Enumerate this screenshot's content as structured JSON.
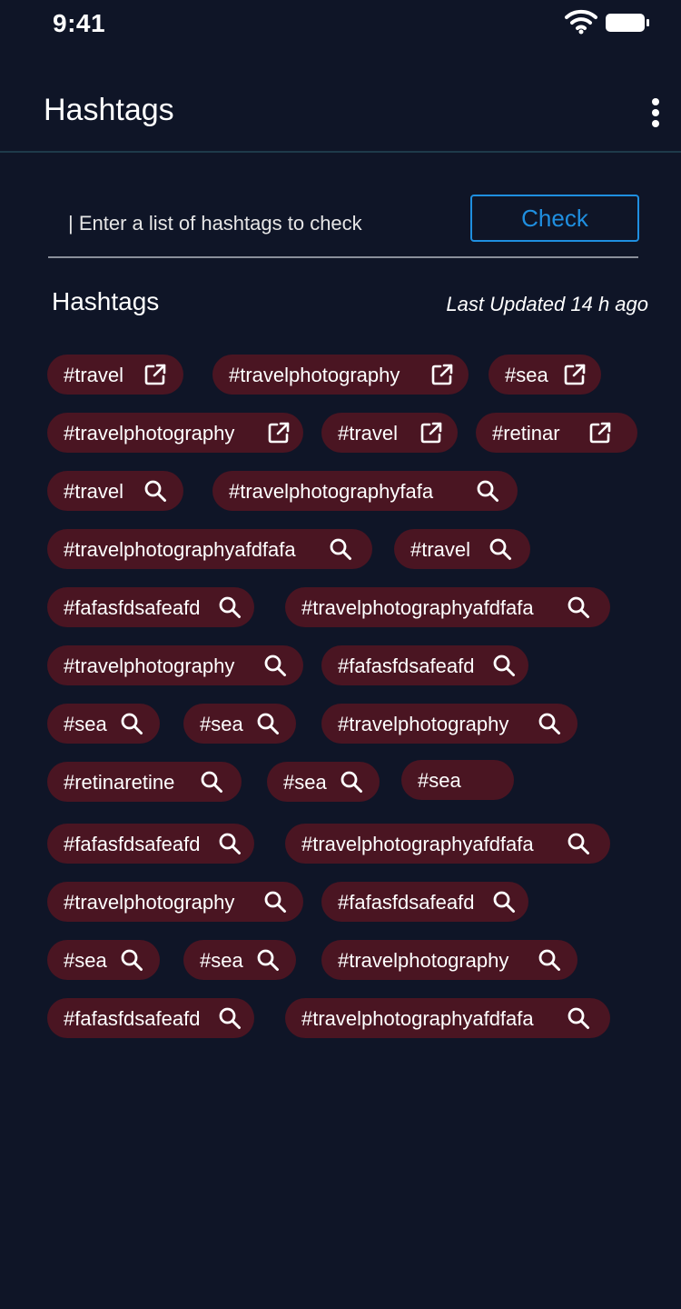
{
  "status_bar": {
    "time": "9:41"
  },
  "app_bar": {
    "title": "Hashtags"
  },
  "search": {
    "placeholder": "| Enter a list of hashtags to check",
    "value": "",
    "check_label": "Check"
  },
  "section": {
    "title": "Hashtags",
    "last_updated": "Last Updated 14 h ago"
  },
  "colors": {
    "background": "#0f1527",
    "chip": "#4a1522",
    "accent": "#1f8fe0"
  },
  "tags": [
    {
      "label": "#travel",
      "icon": "external-link-icon"
    },
    {
      "label": "#travelphotography",
      "icon": "external-link-icon"
    },
    {
      "label": "#sea",
      "icon": "external-link-icon"
    },
    {
      "label": "#travelphotography",
      "icon": "external-link-icon"
    },
    {
      "label": "#travel",
      "icon": "external-link-icon"
    },
    {
      "label": "#retinar",
      "icon": "external-link-icon"
    },
    {
      "label": "#travel",
      "icon": "search-icon"
    },
    {
      "label": "#travelphotographyfafa",
      "icon": "search-icon"
    },
    {
      "label": "#travelphotographyafdfafa",
      "icon": "search-icon"
    },
    {
      "label": "#travel",
      "icon": "search-icon"
    },
    {
      "label": "#fafasfdsafeafd",
      "icon": "search-icon"
    },
    {
      "label": "#travelphotographyafdfafa",
      "icon": "search-icon"
    },
    {
      "label": "#travelphotography",
      "icon": "search-icon"
    },
    {
      "label": "#fafasfdsafeafd",
      "icon": "search-icon"
    },
    {
      "label": "#sea",
      "icon": "search-icon"
    },
    {
      "label": "#sea",
      "icon": "search-icon"
    },
    {
      "label": "#travelphotography",
      "icon": "search-icon"
    },
    {
      "label": "#retinaretine",
      "icon": "search-icon"
    },
    {
      "label": "#sea",
      "icon": "search-icon"
    },
    {
      "label": "#sea",
      "icon": "none"
    },
    {
      "label": "#fafasfdsafeafd",
      "icon": "search-icon"
    },
    {
      "label": "#travelphotographyafdfafa",
      "icon": "search-icon"
    },
    {
      "label": "#travelphotography",
      "icon": "search-icon"
    },
    {
      "label": "#fafasfdsafeafd",
      "icon": "search-icon"
    },
    {
      "label": "#sea",
      "icon": "search-icon"
    },
    {
      "label": "#sea",
      "icon": "search-icon"
    },
    {
      "label": "#travelphotography",
      "icon": "search-icon"
    },
    {
      "label": "#fafasfdsafeafd",
      "icon": "search-icon"
    },
    {
      "label": "#travelphotographyafdfafa",
      "icon": "search-icon"
    }
  ]
}
